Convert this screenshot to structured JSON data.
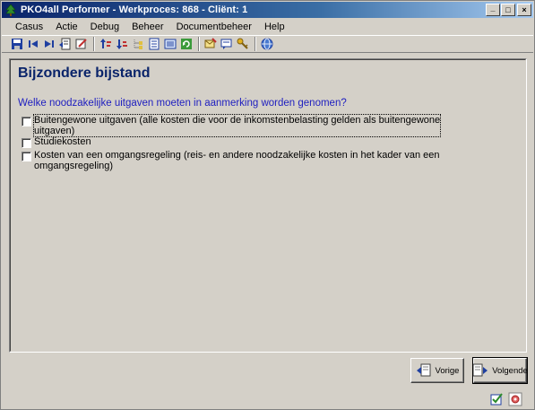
{
  "window": {
    "title": "PKO4all Performer - Werkproces: 868 - Cliënt: 1",
    "controls": {
      "minimize": "_",
      "maximize": "□",
      "close": "×"
    }
  },
  "menu": [
    {
      "label": "Casus"
    },
    {
      "label": "Actie"
    },
    {
      "label": "Debug"
    },
    {
      "label": "Beheer"
    },
    {
      "label": "Documentbeheer"
    },
    {
      "label": "Help"
    }
  ],
  "toolbar": {
    "icons": [
      "save-icon",
      "first-record-icon",
      "last-record-icon",
      "open-case-icon",
      "edit-case-icon",
      "sort-asc-icon",
      "sort-desc-icon",
      "tree-icon",
      "document-icon",
      "list-icon",
      "refresh-icon",
      "send-icon",
      "message-icon",
      "key-icon",
      "globe-icon"
    ]
  },
  "page": {
    "title": "Bijzondere bijstand",
    "question": "Welke noodzakelijke uitgaven moeten in aanmerking worden genomen?",
    "options": [
      {
        "line1": "Buitengewone uitgaven (alle kosten die voor de inkomstenbelasting gelden als buitengewone",
        "line2": "uitgaven)",
        "checked": false
      },
      {
        "line1": "Studiekosten",
        "line2": "",
        "checked": false
      },
      {
        "line1": "Kosten van een omgangsregeling (reis- en andere noodzakelijke kosten in het kader van een",
        "line2": "omgangsregeling)",
        "checked": false
      }
    ]
  },
  "buttons": {
    "previous": "Vorige",
    "next": "Volgende"
  },
  "status": {
    "icons": [
      "check-edit-icon",
      "settings-icon"
    ]
  }
}
